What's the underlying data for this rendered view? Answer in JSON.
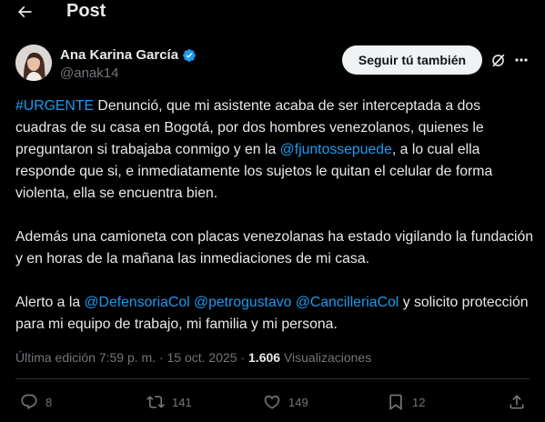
{
  "header": {
    "title": "Post"
  },
  "author": {
    "name": "Ana Karina García",
    "handle": "@anak14",
    "follow_label": "Seguir tú también"
  },
  "tweet": {
    "p1": {
      "hashtag": "#URGENTE",
      "t1": " Denunció, que mi asistente acaba de ser interceptada a dos cuadras de su casa en Bogotá, por dos hombres venezolanos, quienes le preguntaron si trabajaba conmigo y en la ",
      "mention": "@fjuntossepuede",
      "t2": ", a lo cual ella responde que si, e inmediatamente los sujetos le quitan el celular de forma violenta, ella se encuentra bien."
    },
    "p2": "Además una camioneta con placas venezolanas ha estado vigilando la fundación y en horas de la mañana las inmediaciones de mi casa.",
    "p3": {
      "t1": "Alerto a la ",
      "m1": "@DefensoriaCol",
      "s1": " ",
      "m2": "@petrogustavo",
      "s2": " ",
      "m3": "@CancilleriaCol",
      "t2": " y solicito protección para mi equipo de trabajo, mi familia y mi persona."
    }
  },
  "meta": {
    "edited": "Última edición 7:59 p. m. · 15 oct. 2025 · ",
    "views_count": "1.606",
    "views_label": " Visualizaciones"
  },
  "actions": {
    "replies": "8",
    "reposts": "141",
    "likes": "149",
    "bookmarks": "12"
  },
  "colors": {
    "accent": "#1d9bf0",
    "muted": "#71767b",
    "text": "#e7e9ea",
    "background": "#000000"
  }
}
